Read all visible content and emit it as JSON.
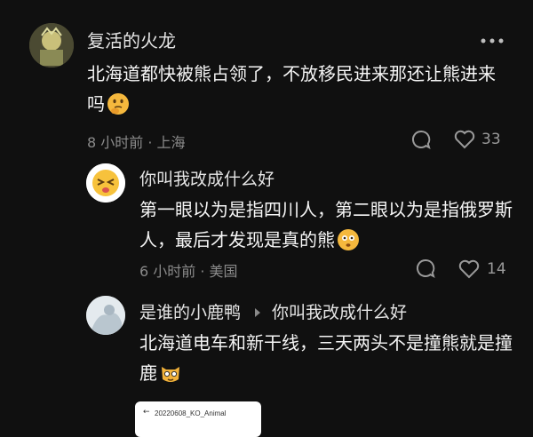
{
  "comments": [
    {
      "user": "复活的火龙",
      "text": "北海道都快被熊占领了，不放移民进来那还让熊进来吗",
      "meta": "8 小时前 · 上海",
      "likes": "33",
      "emoji": "thinking-face-icon"
    },
    {
      "user": "你叫我改成什么好",
      "text": "第一眼以为是指四川人，第二眼以为是指俄罗斯人，最后才发现是真的熊",
      "meta": "6 小时前 · 美国",
      "likes": "14",
      "emoji": "flushed-face-icon"
    },
    {
      "user": "是谁的小鹿鸭",
      "reply_to": "你叫我改成什么好",
      "text": "北海道电车和新干线，三天两头不是撞熊就是撞鹿",
      "emoji": "cat-face-icon"
    }
  ],
  "attachment": {
    "title": "20220608_KO_Animal"
  },
  "colors": {
    "background": "#101010",
    "text": "#f5f5f5",
    "meta": "#8a8a8a"
  }
}
